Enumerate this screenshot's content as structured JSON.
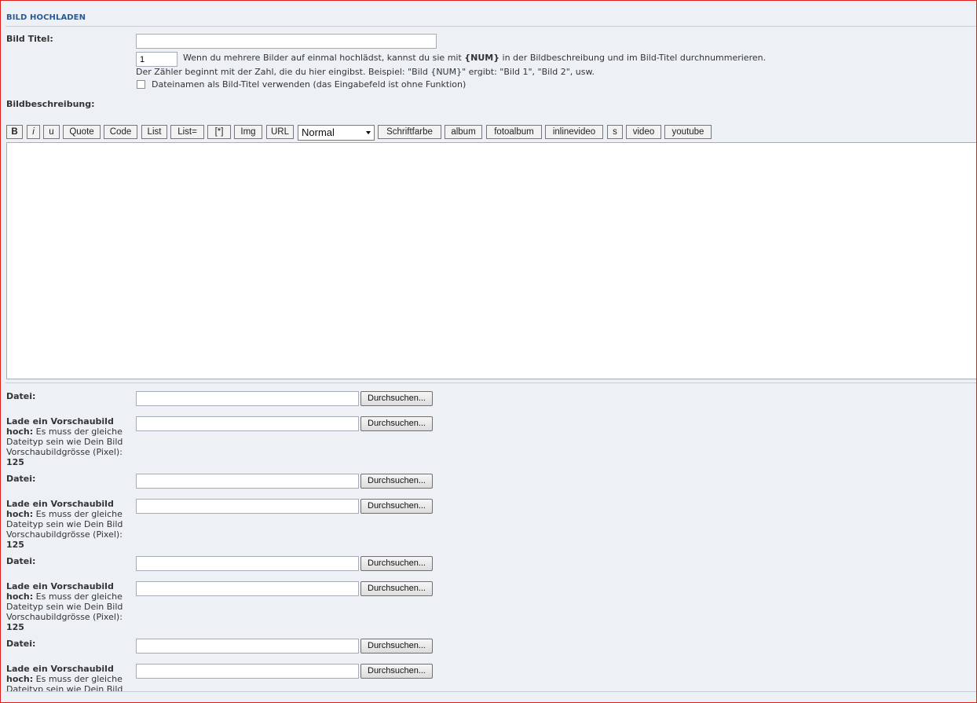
{
  "section_title": "BILD HOCHLADEN",
  "title_label": "Bild Titel:",
  "title_value": "",
  "counter_value": "1",
  "counter_help_prefix": "Wenn du mehrere Bilder auf einmal hochlädst, kannst du sie mit",
  "counter_help_num": "{NUM}",
  "counter_help_suffix": "in der Bildbeschreibung und im Bild-Titel durchnummerieren.",
  "counter_help2": "Der Zähler beginnt mit der Zahl, die du hier eingibst. Beispiel: \"Bild {NUM}\" ergibt: \"Bild 1\", \"Bild 2\", usw.",
  "filename_checkbox_label": "Dateinamen als Bild-Titel verwenden (das Eingabefeld ist ohne Funktion)",
  "description_label": "Bildbeschreibung:",
  "toolbar": {
    "b": "B",
    "i": "i",
    "u": "u",
    "quote": "Quote",
    "code": "Code",
    "list": "List",
    "list_eq": "List=",
    "star": "[*]",
    "img": "Img",
    "url": "URL",
    "size_select": "Normal",
    "color": "Schriftfarbe",
    "album": "album",
    "fotoalbum": "fotoalbum",
    "inlinevideo": "inlinevideo",
    "s": "s",
    "video": "video",
    "youtube": "youtube"
  },
  "uploads": [
    {
      "file_label": "Datei:",
      "thumb_label_bold": "Lade ein Vorschaubild hoch:",
      "thumb_label_text": "Es muss der gleiche Dateityp sein wie Dein Bild Vorschaubildgrösse (Pixel):",
      "thumb_size": "125"
    },
    {
      "file_label": "Datei:",
      "thumb_label_bold": "Lade ein Vorschaubild hoch:",
      "thumb_label_text": "Es muss der gleiche Dateityp sein wie Dein Bild Vorschaubildgrösse (Pixel):",
      "thumb_size": "125"
    },
    {
      "file_label": "Datei:",
      "thumb_label_bold": "Lade ein Vorschaubild hoch:",
      "thumb_label_text": "Es muss der gleiche Dateityp sein wie Dein Bild Vorschaubildgrösse (Pixel):",
      "thumb_size": "125"
    },
    {
      "file_label": "Datei:",
      "thumb_label_bold": "Lade ein Vorschaubild hoch:",
      "thumb_label_text": "Es muss der gleiche Dateityp sein wie Dein Bild",
      "thumb_size": ""
    }
  ],
  "browse_label": "Durchsuchen..."
}
